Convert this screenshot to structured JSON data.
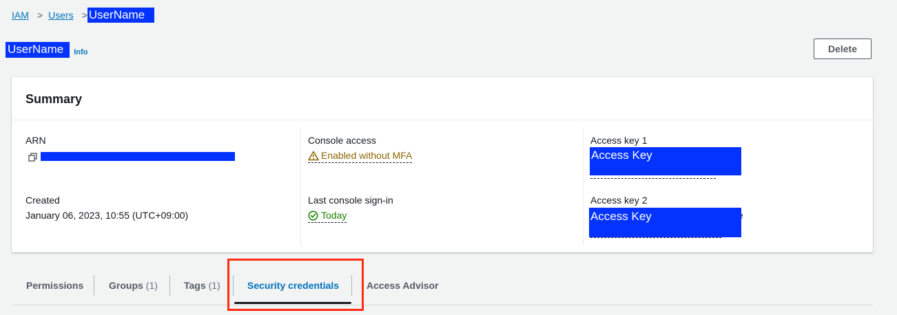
{
  "breadcrumb": {
    "items": [
      "IAM",
      "Users"
    ],
    "current": "UserName",
    "separator": ">"
  },
  "page": {
    "title": "UserName",
    "info_label": "Info",
    "delete_label": "Delete"
  },
  "summary": {
    "heading": "Summary",
    "arn": {
      "label": "ARN",
      "copy_icon": "copy-icon"
    },
    "created": {
      "label": "Created",
      "value": "January 06, 2023, 10:55 (UTC+09:00)"
    },
    "console_access": {
      "label": "Console access",
      "value": "Enabled without MFA",
      "icon": "warning-icon"
    },
    "last_signin": {
      "label": "Last console sign-in",
      "value": "Today",
      "icon": "check-circle-icon"
    },
    "access_key_1": {
      "label": "Access key 1",
      "value": "Access Key"
    },
    "access_key_2": {
      "label": "Access key 2",
      "value": "Access Key",
      "trailing": "e"
    }
  },
  "tabs": [
    {
      "label": "Permissions",
      "count": ""
    },
    {
      "label": "Groups",
      "count": "(1)"
    },
    {
      "label": "Tags",
      "count": "(1)"
    },
    {
      "label": "Security credentials",
      "count": ""
    },
    {
      "label": "Access Advisor",
      "count": ""
    }
  ],
  "colors": {
    "link": "#0073bb",
    "redaction": "#0433ff",
    "warning": "#8d6605",
    "success": "#1d8102",
    "highlight": "#ff2b12"
  }
}
